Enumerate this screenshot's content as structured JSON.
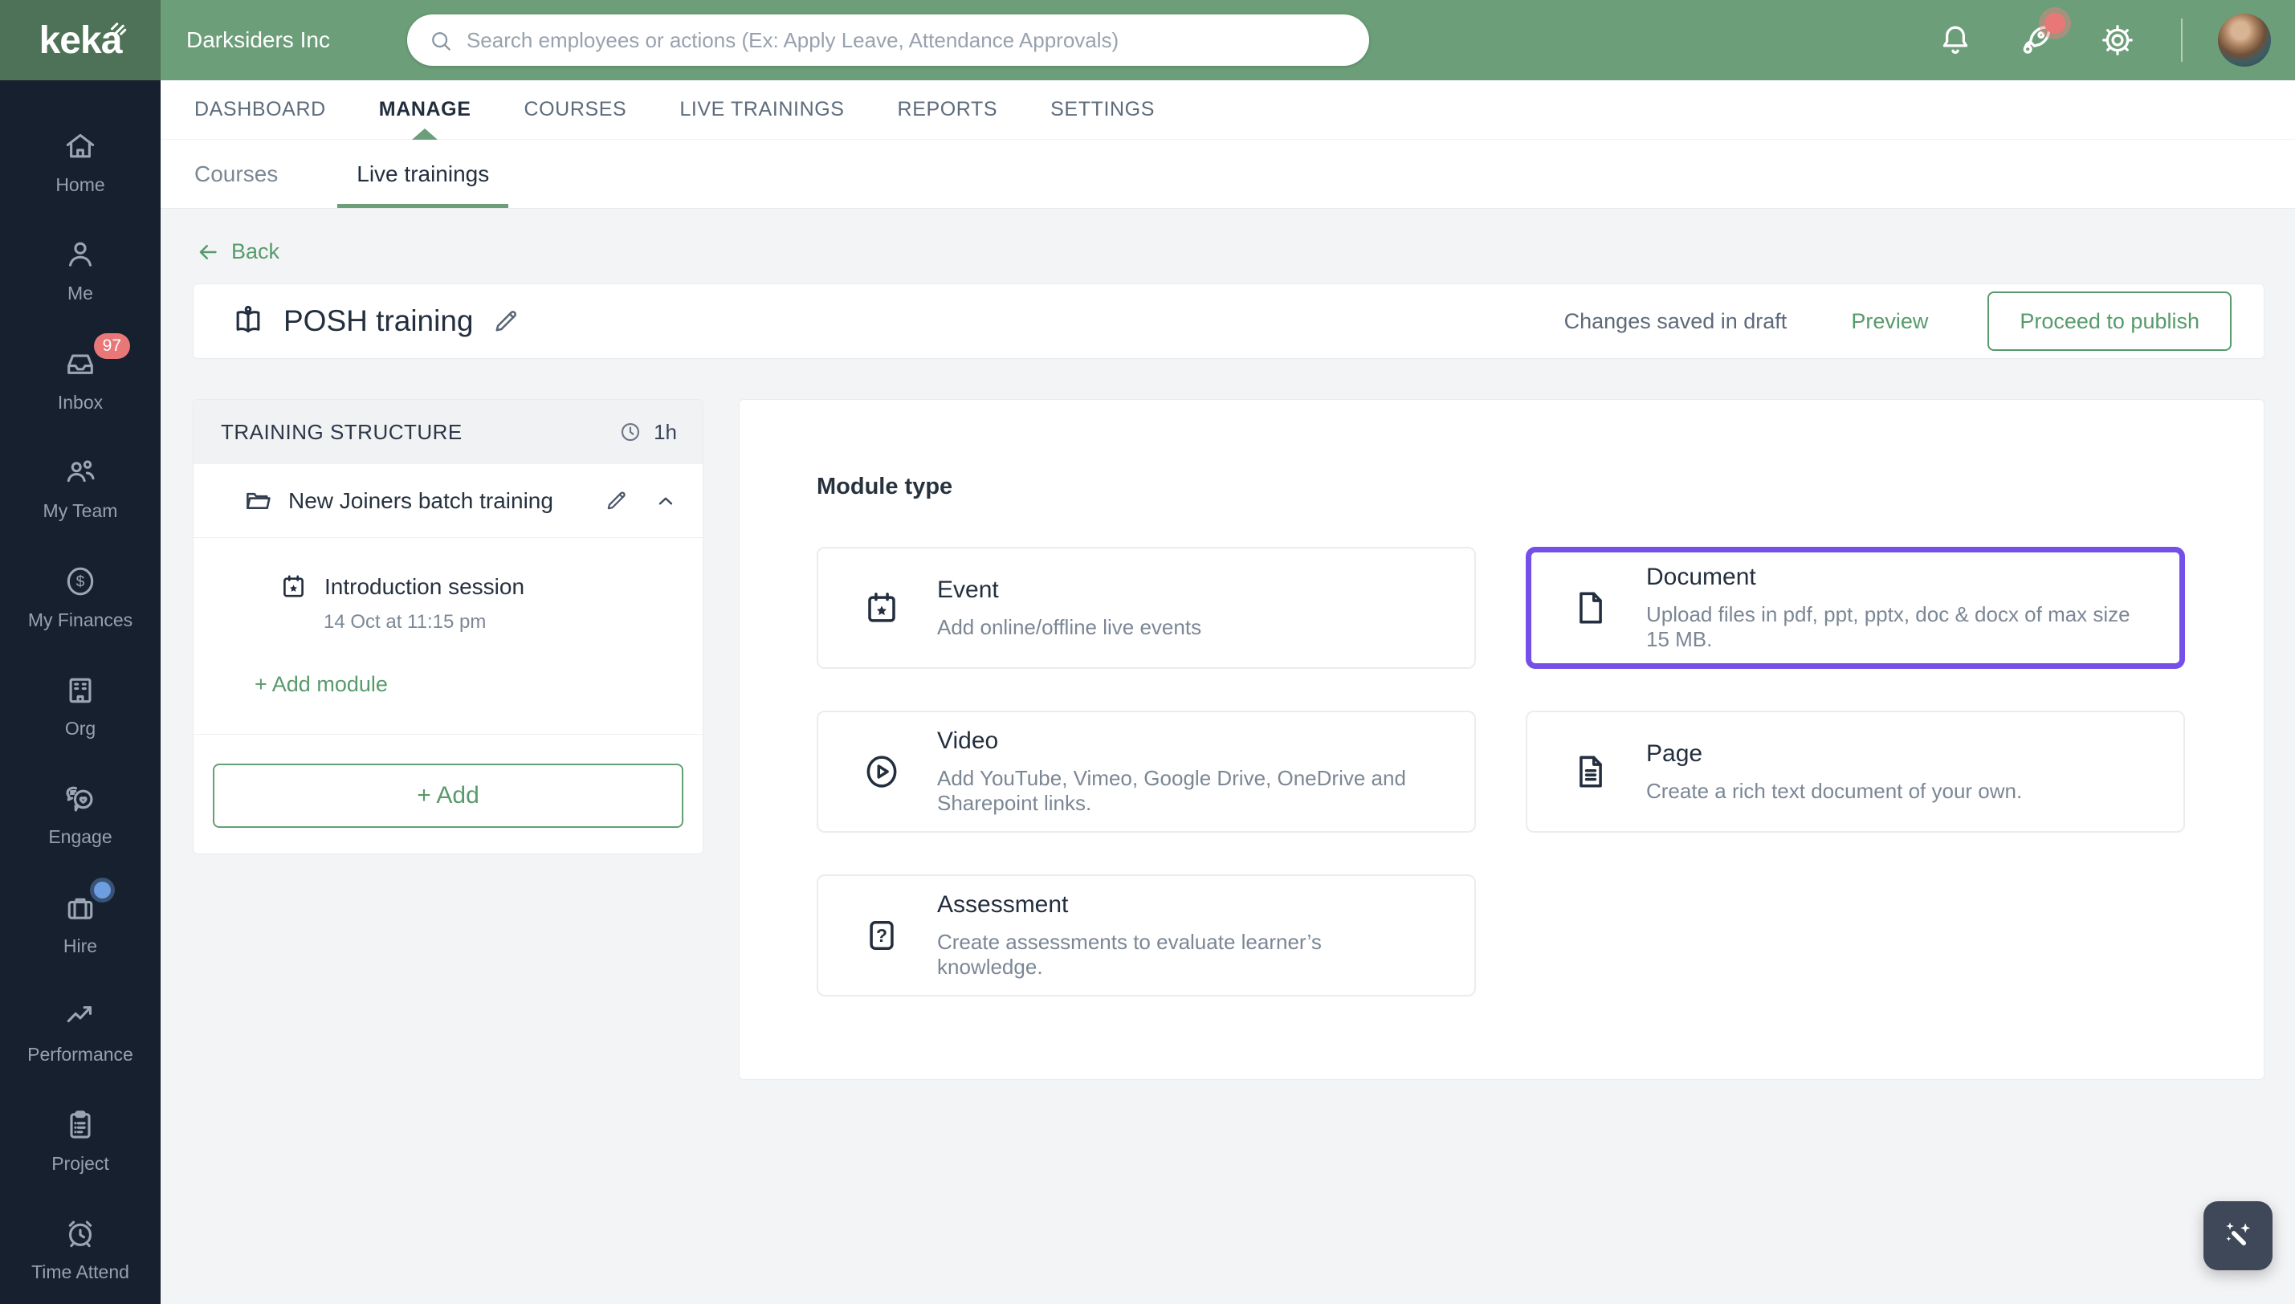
{
  "colors": {
    "topbar": "#6b9e79",
    "logobox": "#4e7257",
    "sidebar": "#16202e",
    "accent": "#579a6b",
    "accent-underline": "#6b9e79",
    "purple": "#7450e8",
    "badge": "#e87878",
    "hire-dot": "#6d9ee0",
    "page-bg": "#f3f4f6",
    "wand-bg": "#3e4858"
  },
  "topbar": {
    "logo": "keka",
    "company": "Darksiders Inc",
    "search_placeholder": "Search employees or actions (Ex: Apply Leave, Attendance Approvals)"
  },
  "sidebar": {
    "items": [
      {
        "label": "Home"
      },
      {
        "label": "Me"
      },
      {
        "label": "Inbox",
        "badge": "97"
      },
      {
        "label": "My Team"
      },
      {
        "label": "My Finances"
      },
      {
        "label": "Org"
      },
      {
        "label": "Engage"
      },
      {
        "label": "Hire"
      },
      {
        "label": "Performance"
      },
      {
        "label": "Project"
      },
      {
        "label": "Time Attend"
      }
    ]
  },
  "nav": {
    "tabs": [
      {
        "label": "DASHBOARD"
      },
      {
        "label": "MANAGE",
        "active": true
      },
      {
        "label": "COURSES"
      },
      {
        "label": "LIVE TRAININGS"
      },
      {
        "label": "REPORTS"
      },
      {
        "label": "SETTINGS"
      }
    ]
  },
  "subnav": {
    "tabs": [
      {
        "label": "Courses"
      },
      {
        "label": "Live trainings",
        "active": true
      }
    ]
  },
  "page": {
    "back": "Back",
    "title": "POSH training",
    "status": "Changes saved in draft",
    "preview": "Preview",
    "publish": "Proceed to publish"
  },
  "structure": {
    "header": "TRAINING STRUCTURE",
    "duration": "1h",
    "folder": "New Joiners batch training",
    "module_title": "Introduction session",
    "module_time": "14 Oct at 11:15 pm",
    "add_module": "+ Add module",
    "add": "+ Add"
  },
  "module_type": {
    "heading": "Module type",
    "cards": [
      {
        "title": "Event",
        "desc": "Add online/offline live events",
        "selected": false
      },
      {
        "title": "Document",
        "desc": "Upload files in pdf, ppt, pptx, doc & docx of max size 15 MB.",
        "selected": true
      },
      {
        "title": "Video",
        "desc": "Add YouTube, Vimeo, Google Drive, OneDrive and Sharepoint links.",
        "selected": false
      },
      {
        "title": "Page",
        "desc": "Create a rich text document of your own.",
        "selected": false
      },
      {
        "title": "Assessment",
        "desc": "Create assessments to evaluate learner’s knowledge.",
        "selected": false
      }
    ]
  }
}
